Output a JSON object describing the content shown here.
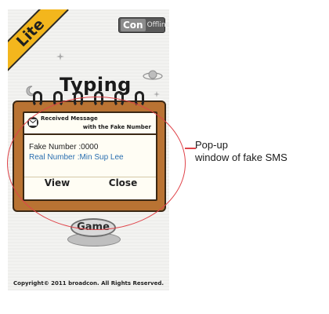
{
  "screen": {
    "lite_badge": "Lite",
    "connection_toggle": {
      "on_label": "Con",
      "off_label": "Offline"
    },
    "app_title": "Typing",
    "game_button_label": "Game",
    "copyright": "Copyright© 2011 broadcon. All Rights Reserved."
  },
  "popup": {
    "header_line1": "Received Message",
    "header_line2": "with the Fake Number",
    "fake_number": "Fake Number :0000",
    "real_number": "Real Number :Min Sup Lee",
    "view_label": "View",
    "close_label": "Close"
  },
  "annotation": {
    "line1": "Pop-up",
    "line2": "window of fake SMS"
  },
  "colors": {
    "highlight": "#e0444a",
    "notebook": "#b97333",
    "paper": "#fffdf4",
    "real_number": "#2a6fb0",
    "lite_badge": "#f3b61d"
  }
}
